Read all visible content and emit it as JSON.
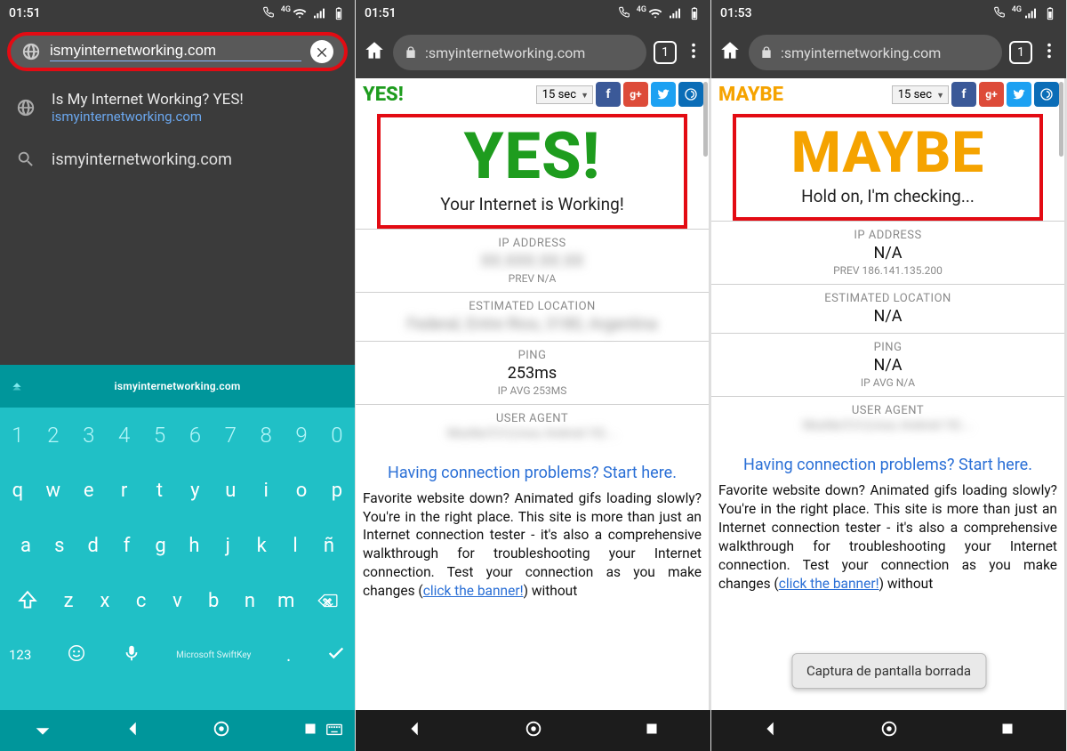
{
  "phones": [
    {
      "time": "01:51",
      "url_typed": "ismyinternetworking.com",
      "suggestions": {
        "top_title": "Is My Internet Working? YES!",
        "top_sub": "ismyinternetworking.com",
        "second": "ismyinternetworking.com"
      },
      "keyboard": {
        "suggestion": "ismyinternetworking.com",
        "numbers": [
          "1",
          "2",
          "3",
          "4",
          "5",
          "6",
          "7",
          "8",
          "9",
          "0"
        ],
        "row2": [
          "q",
          "w",
          "e",
          "r",
          "t",
          "y",
          "u",
          "i",
          "o",
          "p"
        ],
        "row3": [
          "a",
          "s",
          "d",
          "f",
          "g",
          "h",
          "j",
          "k",
          "l",
          "ñ"
        ],
        "row4": [
          "z",
          "x",
          "c",
          "v",
          "b",
          "n",
          "m"
        ],
        "k123": "123",
        "brand": "Microsoft SwiftKey"
      }
    },
    {
      "time": "01:51",
      "url_shown": ":smyinternetworking.com",
      "tabs": "1",
      "mini": "YES!",
      "refresh": "15 sec",
      "hero_big": "YES!",
      "hero_sub": "Your Internet is Working!",
      "ip": {
        "label": "IP ADDRESS",
        "value_blurred": "XX.XXX.XX.XX",
        "prev": "PREV N/A"
      },
      "loc": {
        "label": "ESTIMATED LOCATION",
        "value_blurred": "Federal, Entre Rios, 3180, Argentina"
      },
      "ping": {
        "label": "PING",
        "value": "253ms",
        "sub": "IP AVG 253MS"
      },
      "ua": {
        "label": "USER AGENT",
        "value_blurred": "Mozilla/5.0 (Linux; Android 10) ..."
      },
      "help": "Having connection problems? Start here.",
      "para_a": "Favorite website down? Animated gifs loading slowly? You're in the right place. This site is more than just an Internet connection tester - it's also a comprehensive walkthrough for troubleshooting your Internet connection. Test your connection as you make changes (",
      "para_link": "click the banner!",
      "para_b": ") without"
    },
    {
      "time": "01:53",
      "url_shown": ":smyinternetworking.com",
      "tabs": "1",
      "mini": "MAYBE",
      "refresh": "15 sec",
      "hero_big": "MAYBE",
      "hero_sub": "Hold on, I'm checking...",
      "ip": {
        "label": "IP ADDRESS",
        "value": "N/A",
        "prev": "PREV 186.141.135.200"
      },
      "loc": {
        "label": "ESTIMATED LOCATION",
        "value": "N/A"
      },
      "ping": {
        "label": "PING",
        "value": "N/A",
        "sub": "IP AVG N/A"
      },
      "ua": {
        "label": "USER AGENT",
        "value_blurred": "Mozilla/5.0 (Linux; Android 10) ..."
      },
      "help": "Having connection problems? Start here.",
      "para_a": "Favorite website down? Animated gifs loading slowly? You're in the right place. This site is more than just an Internet connection tester - it's also a comprehensive walkthrough for troubleshooting your Internet connection. Test your connection as you make changes (",
      "para_link": "click the banner!",
      "para_b": ") without",
      "toast": "Captura de pantalla borrada"
    }
  ]
}
